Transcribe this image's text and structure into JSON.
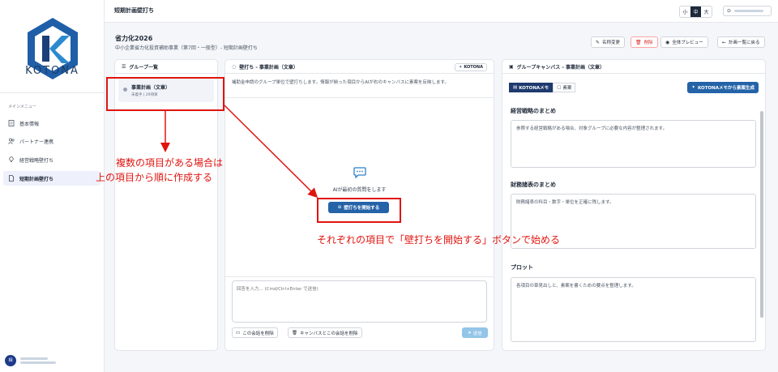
{
  "app": {
    "brand": "KOTONA",
    "page_title": "短期計画壁打ち"
  },
  "sidebar": {
    "menu_title": "メインメニュー",
    "items": [
      {
        "label": "基本情報",
        "icon": "document-icon"
      },
      {
        "label": "パートナー連携",
        "icon": "users-icon"
      },
      {
        "label": "経営戦略壁打ち",
        "icon": "bulb-icon"
      },
      {
        "label": "短期計画壁打ち",
        "icon": "file-icon",
        "active": true
      }
    ],
    "user_avatar": "相"
  },
  "header": {
    "font_sizes": [
      "小",
      "中",
      "大"
    ],
    "active_size": "中"
  },
  "plan": {
    "title": "省力化2026",
    "subtitle": "中小企業省力化投資補助事業（第7回・一般型）- 短期計画壁打ち",
    "buttons": {
      "rename": "名称変更",
      "delete": "削除",
      "preview": "全体プレビュー",
      "back": "計画一覧に戻る"
    }
  },
  "group_panel": {
    "title": "グループ一覧",
    "item_name": "事業計画（文章）",
    "item_meta": "未着手 | 29項目"
  },
  "chat_panel": {
    "title": "壁打ち - 事業計画（文章）",
    "badge": "KOTONA",
    "description": "補助金申請のグループ単位で壁打ちします。情報が揃った項目からAIが右のキャンバスに素案を反映します。",
    "empty_prompt": "AIが最初の質問をします",
    "start_button": "壁打ちを開始する",
    "input_placeholder": "回答を入力... (Cmd/Ctrl+Enter で送信)",
    "delete_chat": "この会話を削除",
    "delete_all": "キャンバスとこの会話を削除",
    "send": "送信"
  },
  "canvas_panel": {
    "title": "グループキャンバス - 事業計画（文章）",
    "tab_memo": "KOTONAメモ",
    "tab_draft": "素案",
    "generate_button": "KOTONAメモから素案生成",
    "sections": [
      {
        "title": "経営戦略のまとめ",
        "text": "参照する経営戦略がある場合、対象グループに必要な内容が整理されます。"
      },
      {
        "title": "財務諸表のまとめ",
        "text": "財務諸表の科目・数字・単位を正確に残します。"
      },
      {
        "title": "プロット",
        "text": "各項目の章見出しと、素案を書くための要点を整理します。"
      }
    ]
  },
  "annotations": {
    "note1_line1": "複数の項目がある場合は",
    "note1_line2": "上の項目から順に作成する",
    "note2": "それぞれの項目で「壁打ちを開始する」ボタンで始める",
    "color": "#e0140f"
  }
}
